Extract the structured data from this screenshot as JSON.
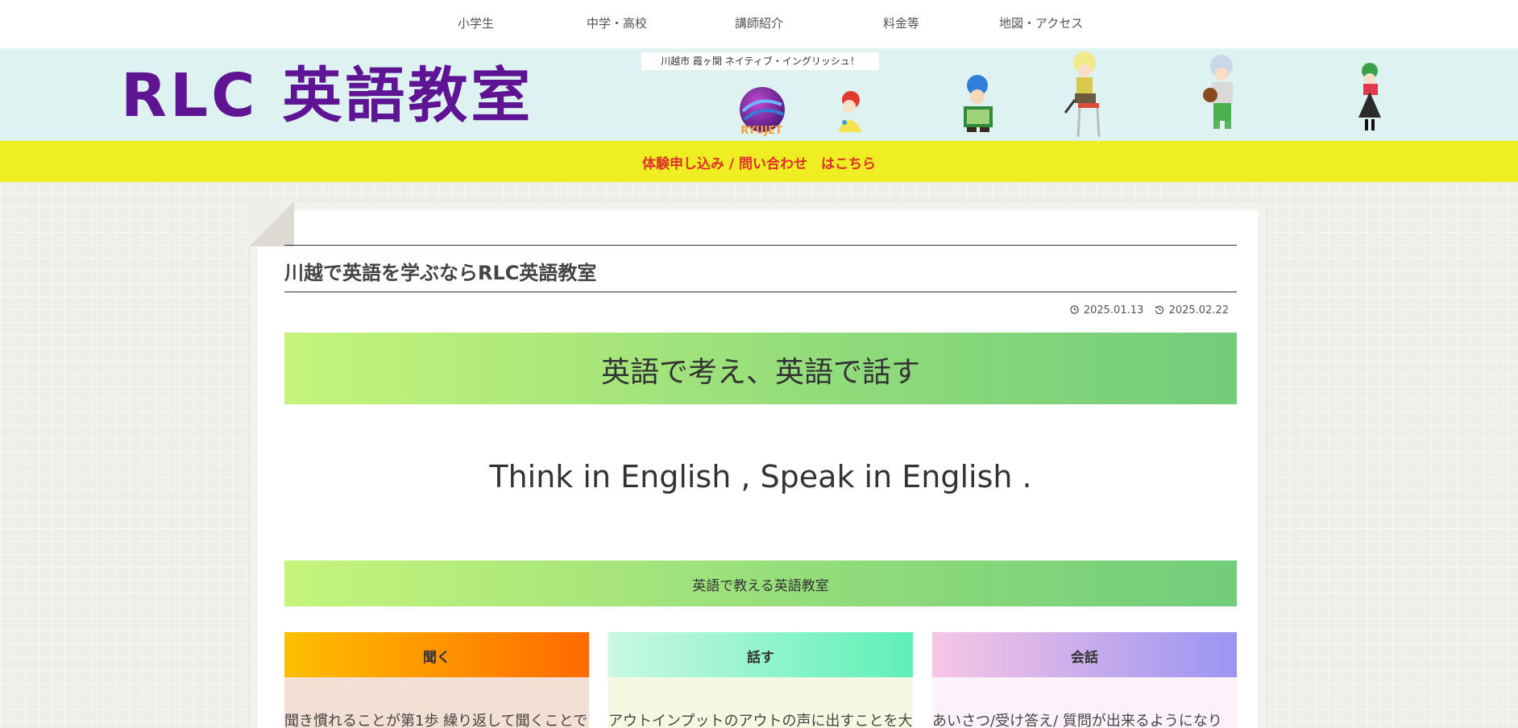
{
  "nav": {
    "items": [
      {
        "label": "小学生"
      },
      {
        "label": "中学・高校"
      },
      {
        "label": "講師紹介"
      },
      {
        "label": "料金等"
      },
      {
        "label": "地図・アクセス"
      }
    ]
  },
  "header": {
    "logo_text": "RLC 英語教室",
    "tagline": "川越市 霞ヶ関 ネイティブ・イングリッシュ！",
    "badge_text": "RYUJET"
  },
  "cta": {
    "label": "体験申し込み / 問い合わせ　はこちら"
  },
  "article": {
    "title": "川越で英語を学ぶならRLC英語教室",
    "published": "2025.01.13",
    "updated": "2025.02.22",
    "banner": "英語で考え、英語で話す",
    "lead": "Think in English , Speak in English .",
    "subbanner": "英語で教える英語教室",
    "columns": [
      {
        "title": "聞く",
        "text": "聞き慣れることが第1歩 繰り返して聞くことで"
      },
      {
        "title": "話す",
        "text": "アウトインプットのアウトの声に出すことを大"
      },
      {
        "title": "会話",
        "text": "あいさつ/受け答え/ 質問が出来るようになり"
      }
    ]
  },
  "colors": {
    "logo": "#5f1494",
    "header_bg": "#def3f1",
    "cta_bg": "#eeee22",
    "cta_text": "#e0302b"
  },
  "icons": {
    "published": "clock-icon",
    "updated": "history-icon"
  }
}
